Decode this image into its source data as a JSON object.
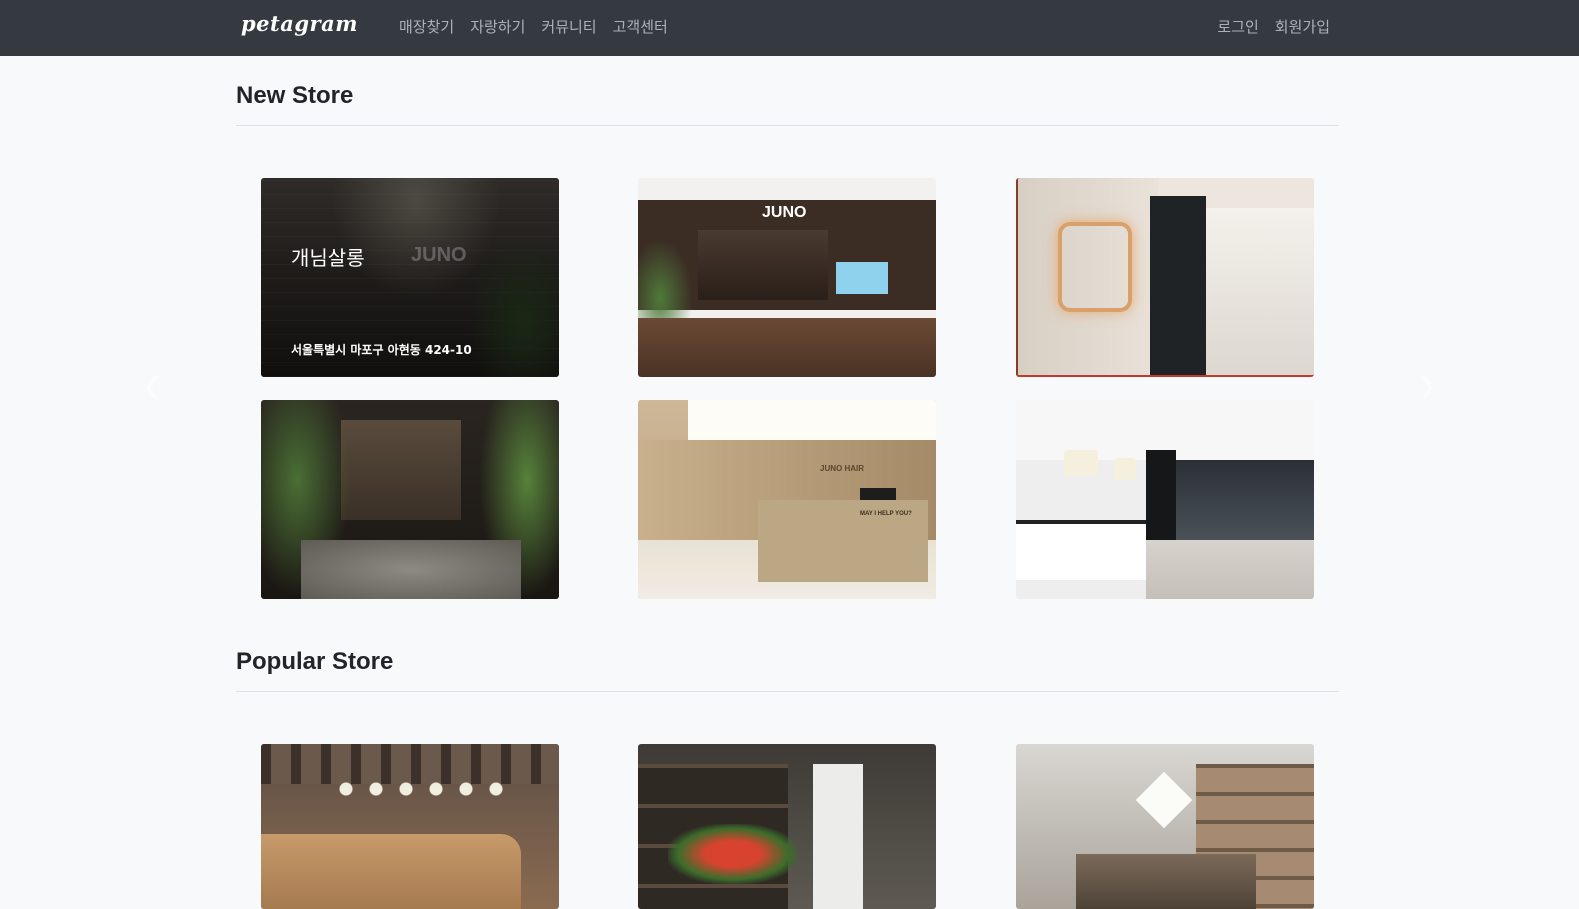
{
  "navbar": {
    "brand": "petagram",
    "links": [
      "매장찾기",
      "자랑하기",
      "커뮤니티",
      "고객센터"
    ],
    "login": "로그인",
    "signup": "회원가입"
  },
  "new_store": {
    "title": "New Store",
    "featured_name": "개님살롱",
    "featured_address": "서울특별시 마포구 아현동 424-10",
    "sign_texts": {
      "featured": "JUNO",
      "storefront": "JUNO",
      "lobby": "JUNO HAIR",
      "lobby_sub": "MAY I HELP YOU?"
    }
  },
  "popular_store": {
    "title": "Popular Store"
  },
  "carousel": {
    "prev_icon": "chevron-left-icon",
    "next_icon": "chevron-right-icon"
  },
  "colors": {
    "navbar_bg": "#343a40",
    "page_bg": "#f8f9fa",
    "nav_text": "rgba(255,255,255,0.6)"
  }
}
